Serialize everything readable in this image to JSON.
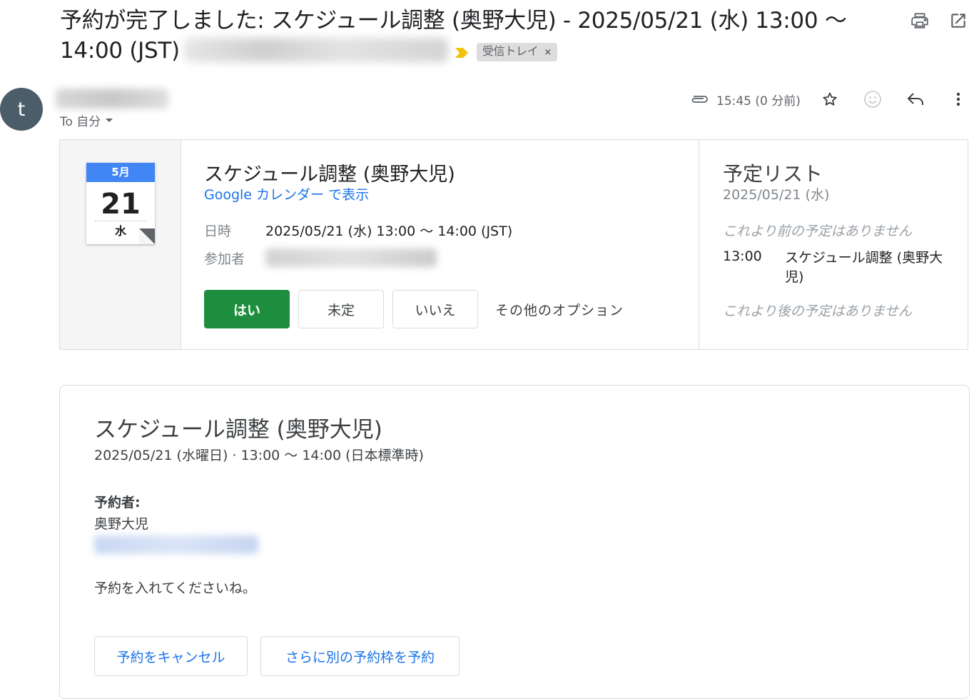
{
  "header": {
    "subject": "予約が完了しました: スケジュール調整 (奥野大児) - 2025/05/21 (水) 13:00 〜 14:00 (JST)",
    "label_chip": "受信トレイ",
    "label_chip_close": "×",
    "icons": [
      "print-icon",
      "open-in-new-window-icon"
    ]
  },
  "sender": {
    "avatar_letter": "t",
    "to_label": "To 自分",
    "time": "15:45 (0 分前)",
    "icons": [
      "attachment-icon",
      "star-icon",
      "emoji-icon",
      "reply-icon",
      "more-vert-icon"
    ]
  },
  "invitation": {
    "calendar": {
      "month": "5月",
      "day": "21",
      "weekday": "水"
    },
    "title": "スケジュール調整 (奥野大児)",
    "view_link": "Google カレンダー で表示",
    "when_label": "日時",
    "when_value": "2025/05/21 (水) 13:00 〜 14:00 (JST)",
    "guests_label": "参加者",
    "rsvp": {
      "yes": "はい",
      "maybe": "未定",
      "no": "いいえ",
      "more": "その他のオプション"
    },
    "agenda": {
      "title": "予定リスト",
      "date": "2025/05/21 (水)",
      "none_before": "これより前の予定はありません",
      "event_time": "13:00",
      "event_title": "スケジュール調整 (奥野大児)",
      "none_after": "これより後の予定はありません"
    }
  },
  "body": {
    "title": "スケジュール調整 (奥野大児)",
    "when": "2025/05/21 (水曜日) · 13:00 〜 14:00 (日本標準時)",
    "booker_label": "予約者:",
    "booker_name": "奥野大児",
    "message": "予約を入れてくださいね。",
    "cancel_button": "予約をキャンセル",
    "book_another_button": "さらに別の予約枠を予約"
  },
  "colors": {
    "accent_blue": "#1a73e8",
    "yes_green": "#1e8e3e",
    "calendar_blue": "#4285f4",
    "importance_yellow": "#f4c20d",
    "avatar_bg": "#4a5d68"
  }
}
